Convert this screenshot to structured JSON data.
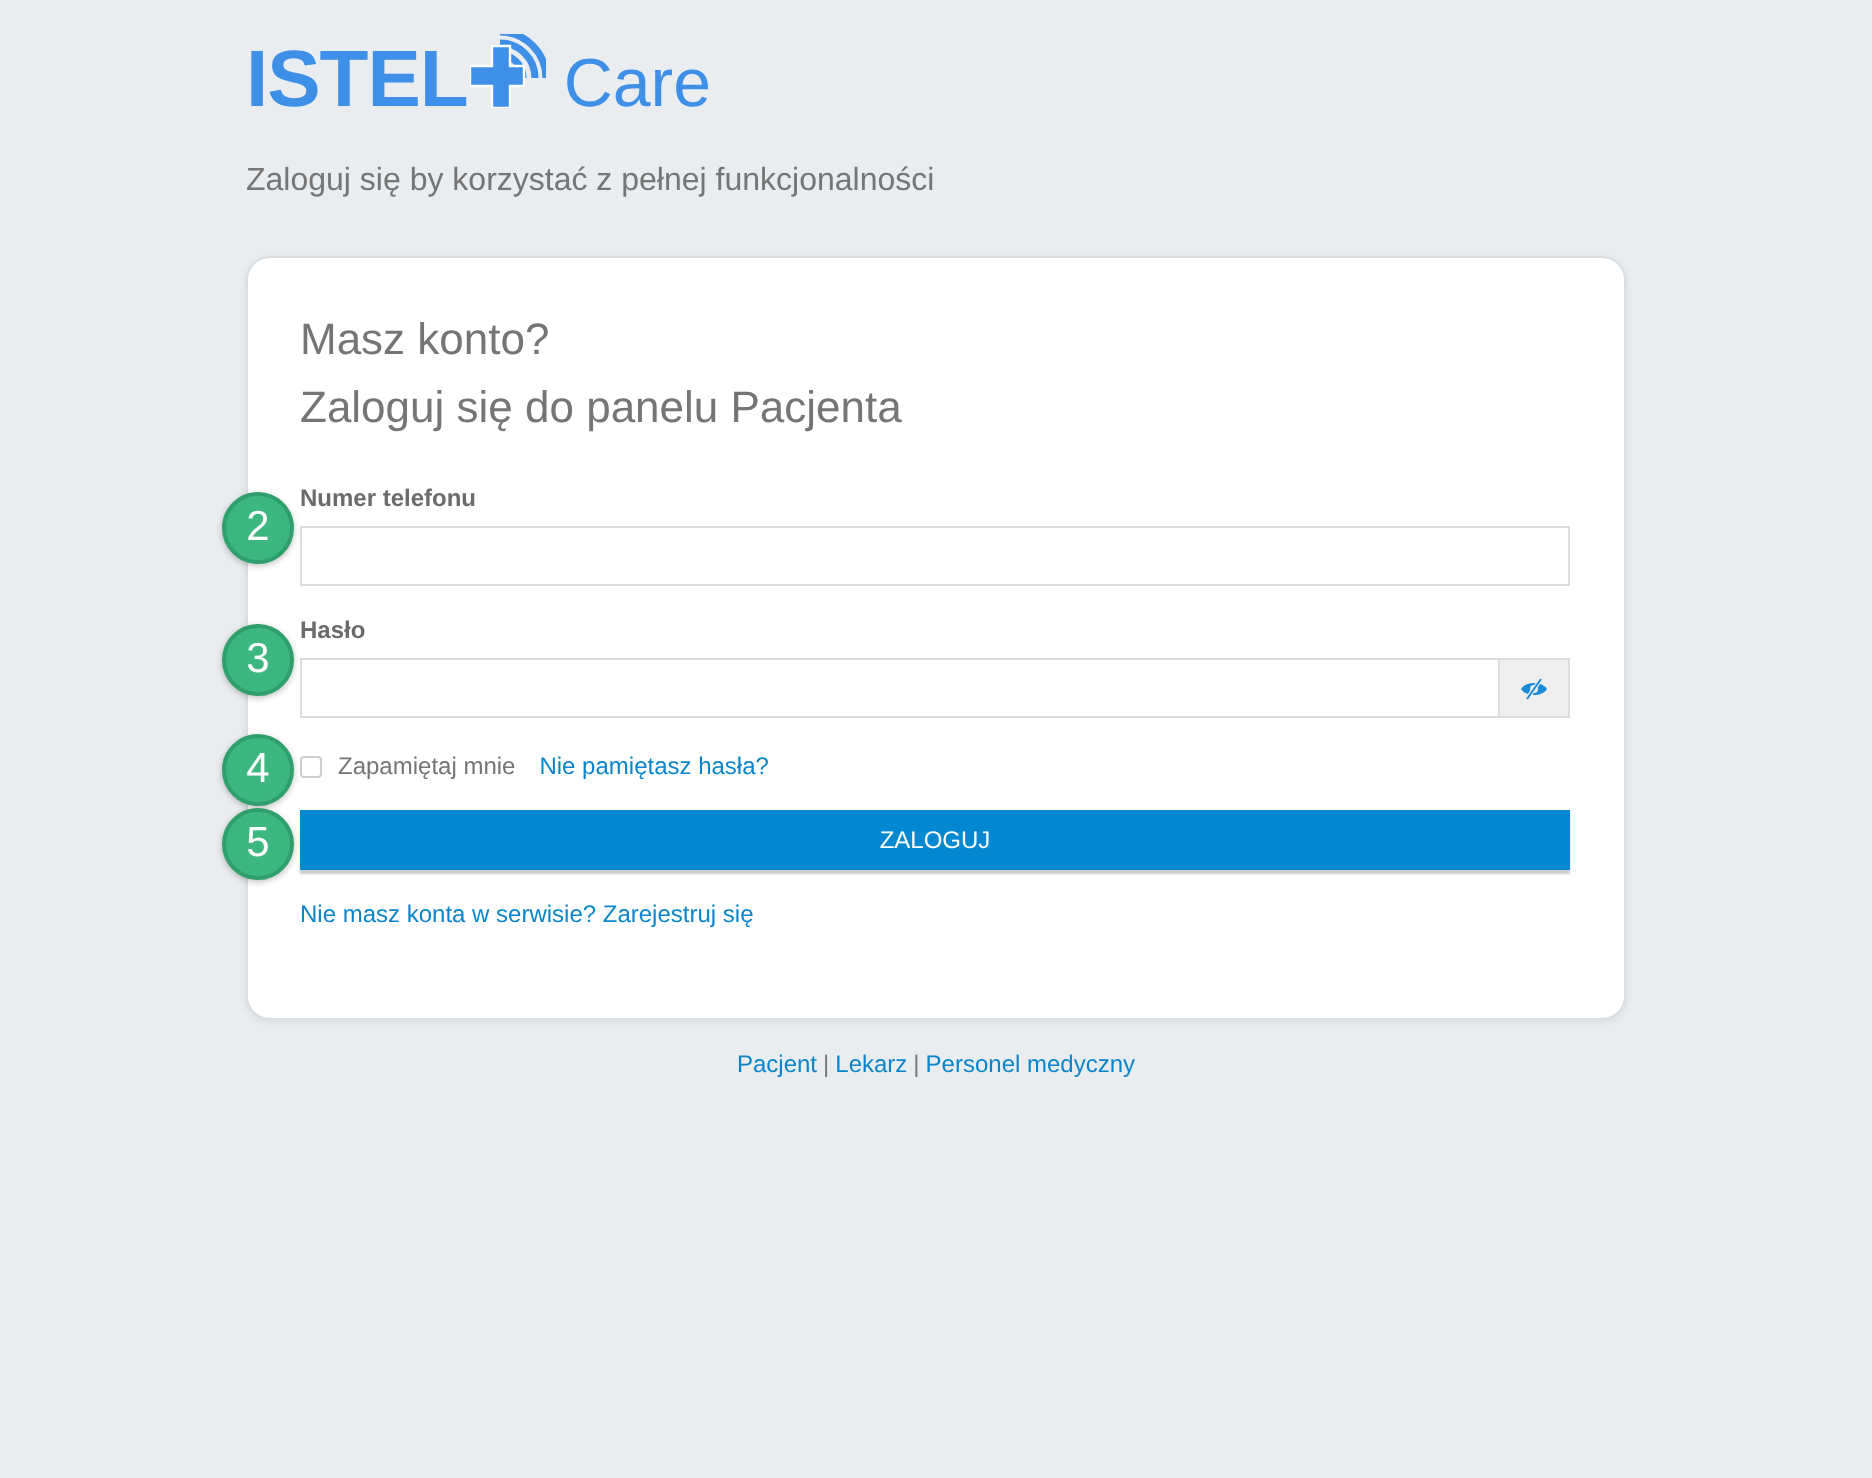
{
  "logo": {
    "brand": "ISTEL",
    "product": "Care"
  },
  "subtitle": "Zaloguj się by korzystać z pełnej funkcjonalności",
  "card": {
    "heading": "Masz konto?",
    "subheading": "Zaloguj się do panelu Pacjenta",
    "fields": [
      {
        "kind": "phone",
        "label": "Numer telefonu",
        "badge": "2"
      },
      {
        "kind": "password",
        "label": "Hasło",
        "badge": "3"
      }
    ],
    "remember": {
      "label": "Zapamiętaj mnie",
      "checked": false,
      "badge": "4"
    },
    "forgot_link": "Nie pamiętasz hasła?",
    "submit": {
      "label": "ZALOGUJ",
      "badge": "5"
    },
    "register_link": "Nie masz konta w serwisie? Zarejestruj się"
  },
  "footer": [
    {
      "kind": "link",
      "label": "Pacjent"
    },
    {
      "kind": "separator",
      "label": "|"
    },
    {
      "kind": "link",
      "label": "Lekarz"
    },
    {
      "kind": "separator",
      "label": "|"
    },
    {
      "kind": "link",
      "label": "Personel medyczny"
    }
  ]
}
